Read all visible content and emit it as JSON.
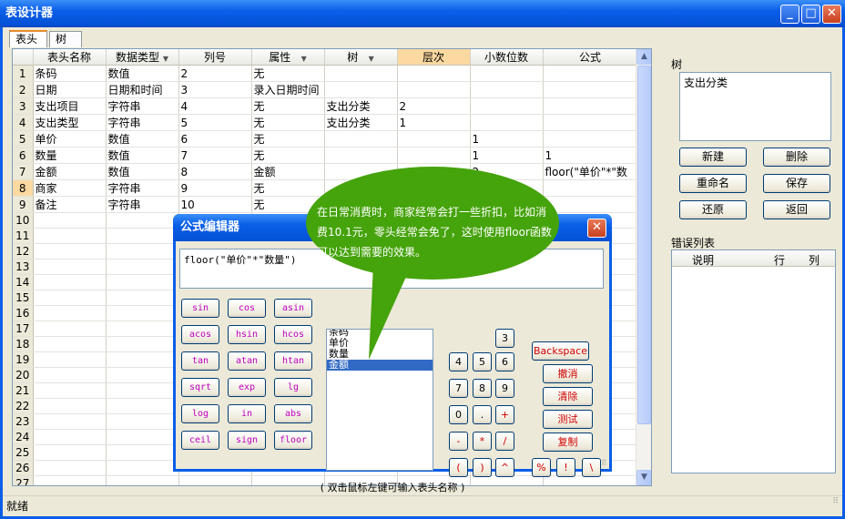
{
  "window": {
    "title": "表设计器",
    "min_icon": "minimize-icon",
    "max_icon": "maximize-icon",
    "close_icon": "close-icon"
  },
  "tabs": [
    {
      "label": "表头",
      "active": true
    },
    {
      "label": "树",
      "active": false
    }
  ],
  "grid": {
    "columns": [
      "表头名称",
      "数据类型",
      "列号",
      "属性",
      "树",
      "层次",
      "小数位数",
      "公式"
    ],
    "rows": [
      [
        "1",
        "条码",
        "数值",
        "2",
        "无",
        "",
        "",
        "",
        ""
      ],
      [
        "2",
        "日期",
        "日期和时间",
        "3",
        "录入日期时间",
        "",
        "",
        "",
        ""
      ],
      [
        "3",
        "支出项目",
        "字符串",
        "4",
        "无",
        "支出分类",
        "2",
        "",
        ""
      ],
      [
        "4",
        "支出类型",
        "字符串",
        "5",
        "无",
        "支出分类",
        "1",
        "",
        ""
      ],
      [
        "5",
        "单价",
        "数值",
        "6",
        "无",
        "",
        "",
        "1",
        ""
      ],
      [
        "6",
        "数量",
        "数值",
        "7",
        "无",
        "",
        "",
        "1",
        "1"
      ],
      [
        "7",
        "金额",
        "数值",
        "8",
        "金额",
        "",
        "",
        "2",
        "floor(\"单价\"*\"数"
      ],
      [
        "8",
        "商家",
        "字符串",
        "9",
        "无",
        "",
        "",
        "",
        ""
      ],
      [
        "9",
        "备注",
        "字符串",
        "10",
        "无",
        "",
        "",
        "",
        ""
      ],
      [
        "10",
        "",
        "",
        "",
        "",
        "",
        "",
        "",
        ""
      ],
      [
        "11",
        "",
        "",
        "",
        "",
        "",
        "",
        "",
        ""
      ],
      [
        "12",
        "",
        "",
        "",
        "",
        "",
        "",
        "",
        ""
      ],
      [
        "13",
        "",
        "",
        "",
        "",
        "",
        "",
        "",
        ""
      ],
      [
        "14",
        "",
        "",
        "",
        "",
        "",
        "",
        "",
        ""
      ],
      [
        "15",
        "",
        "",
        "",
        "",
        "",
        "",
        "",
        ""
      ],
      [
        "16",
        "",
        "",
        "",
        "",
        "",
        "",
        "",
        ""
      ],
      [
        "17",
        "",
        "",
        "",
        "",
        "",
        "",
        "",
        ""
      ],
      [
        "18",
        "",
        "",
        "",
        "",
        "",
        "",
        "",
        ""
      ],
      [
        "19",
        "",
        "",
        "",
        "",
        "",
        "",
        "",
        ""
      ],
      [
        "20",
        "",
        "",
        "",
        "",
        "",
        "",
        "",
        ""
      ],
      [
        "21",
        "",
        "",
        "",
        "",
        "",
        "",
        "",
        ""
      ],
      [
        "22",
        "",
        "",
        "",
        "",
        "",
        "",
        "",
        ""
      ],
      [
        "23",
        "",
        "",
        "",
        "",
        "",
        "",
        "",
        ""
      ],
      [
        "24",
        "",
        "",
        "",
        "",
        "",
        "",
        "",
        ""
      ],
      [
        "25",
        "",
        "",
        "",
        "",
        "",
        "",
        "",
        ""
      ],
      [
        "26",
        "",
        "",
        "",
        "",
        "",
        "",
        "",
        ""
      ],
      [
        "27",
        "",
        "",
        "",
        "",
        "",
        "",
        "",
        ""
      ]
    ],
    "selected_row": "8",
    "highlighted_column": "层次"
  },
  "right_panel": {
    "tree_label": "树",
    "tree_items": [
      "支出分类"
    ],
    "buttons": {
      "new": "新建",
      "delete": "删除",
      "rename": "重命名",
      "save": "保存",
      "restore": "还原",
      "back": "返回"
    },
    "error_label": "错误列表",
    "error_columns": [
      "说明",
      "行",
      "列"
    ]
  },
  "status": "就绪",
  "dialog": {
    "title": "公式编辑器",
    "formula": "floor(\"单价\"*\"数量\")",
    "functions": [
      "sin",
      "cos",
      "asin",
      "acos",
      "hsin",
      "hcos",
      "tan",
      "atan",
      "htan",
      "sqrt",
      "exp",
      "lg",
      "log",
      "in",
      "abs",
      "ceil",
      "sign",
      "floor"
    ],
    "fields": [
      "条码",
      "单价",
      "数量",
      "金额"
    ],
    "selected_field": "金额",
    "keys": {
      "k3": "3",
      "k4": "4",
      "k5": "5",
      "k6": "6",
      "k7": "7",
      "k8": "8",
      "k9": "9",
      "k0": "0",
      "kdot": ".",
      "kplus": "+",
      "kminus": "-",
      "kmul": "*",
      "kdiv": "/",
      "klp": "(",
      "krp": ")",
      "kpow": "^",
      "kmod": "%",
      "kexcl": "!",
      "kbs": "\\"
    },
    "actions": {
      "backspace": "Backspace",
      "undo": "撤消",
      "clear": "清除",
      "test": "测试",
      "copy": "复制"
    },
    "hint": "( 双击鼠标左键可输入表头名称 )"
  },
  "callout": {
    "text": "在日常消费时，商家经常会打一些折扣，比如消费10.1元，零头经常会免了，这时使用floor函数可以达到需要的效果。",
    "color": "#45a30b"
  }
}
